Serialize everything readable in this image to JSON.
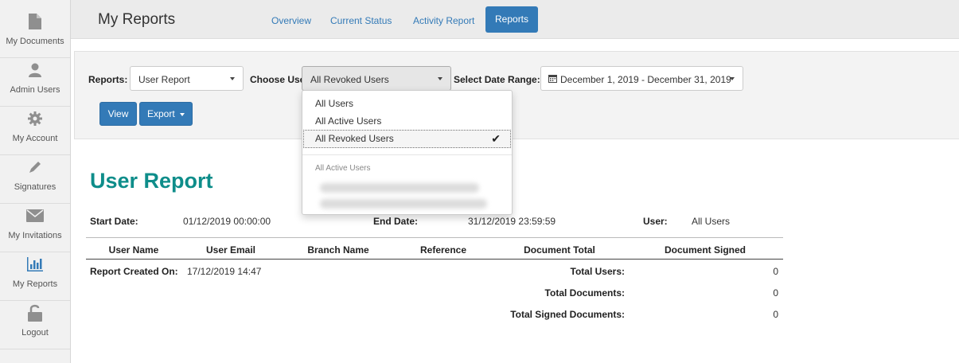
{
  "header": {
    "title": "My Reports",
    "tabs": [
      "Overview",
      "Current Status",
      "Activity Report",
      "Reports"
    ],
    "active_tab": "Reports"
  },
  "sidebar": {
    "items": [
      {
        "label": "My Documents",
        "icon": "document-icon"
      },
      {
        "label": "Admin Users",
        "icon": "user-icon"
      },
      {
        "label": "My Account",
        "icon": "gear-icon"
      },
      {
        "label": "Signatures",
        "icon": "pen-icon"
      },
      {
        "label": "My Invitations",
        "icon": "envelope-icon"
      },
      {
        "label": "My Reports",
        "icon": "bar-chart-icon"
      },
      {
        "label": "Logout",
        "icon": "unlock-icon"
      }
    ],
    "active": "My Reports"
  },
  "filters": {
    "reports_label": "Reports:",
    "reports_value": "User Report",
    "user_label": "Choose User:",
    "user_value": "All Revoked Users",
    "date_label": "Select Date Range:",
    "date_value": "December 1, 2019 - December 31, 2019",
    "view_label": "View",
    "export_label": "Export"
  },
  "user_dropdown": {
    "options": [
      "All Users",
      "All Active Users",
      "All Revoked Users"
    ],
    "selected": "All Revoked Users",
    "group_header": "All Active Users"
  },
  "report": {
    "title": "User Report",
    "start_label": "Start Date:",
    "start_value": "01/12/2019 00:00:00",
    "end_label": "End Date:",
    "end_value": "31/12/2019 23:59:59",
    "user_label": "User:",
    "user_value": "All Users",
    "columns": [
      "User Name",
      "User Email",
      "Branch Name",
      "Reference",
      "Document Total",
      "Document Signed"
    ],
    "created_label": "Report Created On:",
    "created_value": "17/12/2019 14:47",
    "totals": [
      {
        "label": "Total Users:",
        "value": "0"
      },
      {
        "label": "Total Documents:",
        "value": "0"
      },
      {
        "label": "Total Signed Documents:",
        "value": "0"
      }
    ]
  },
  "colors": {
    "accent": "#337ab7",
    "title_teal": "#0e8d8a"
  }
}
